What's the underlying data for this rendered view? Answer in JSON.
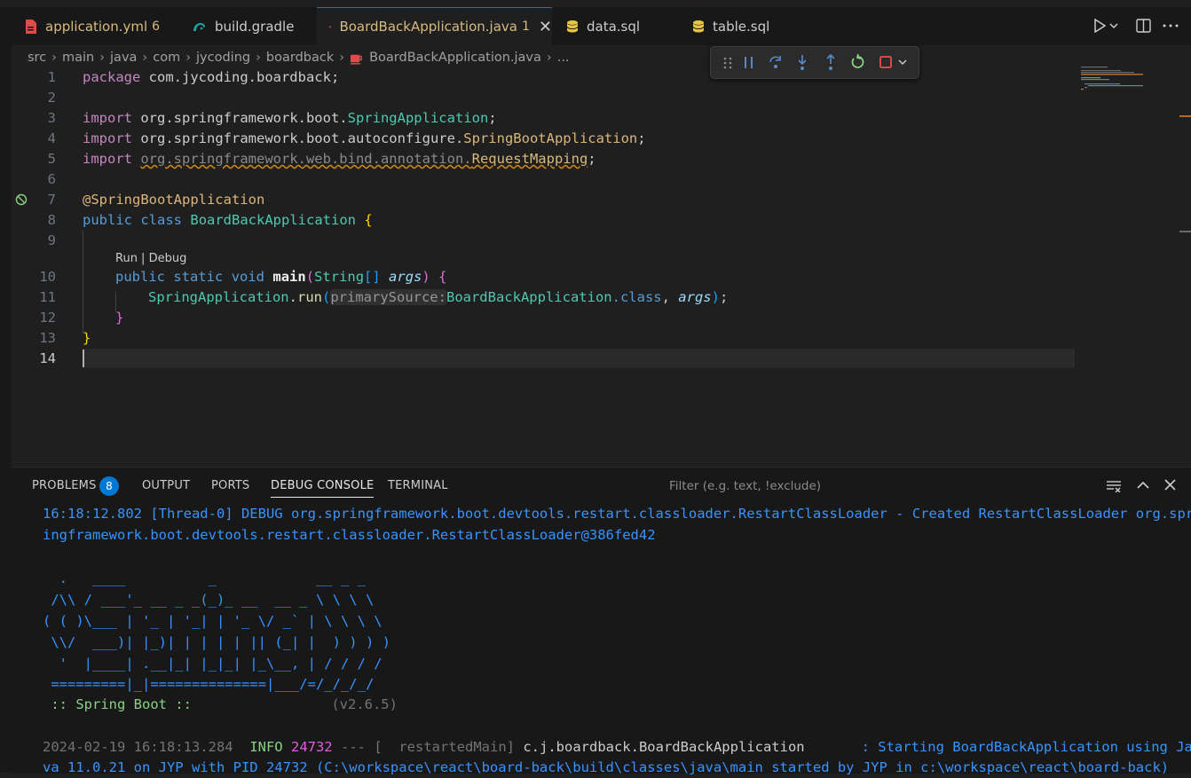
{
  "tabs": [
    {
      "label": "application.yml",
      "badge": "6",
      "color": "#d7ba7d",
      "icon": "yaml-icon"
    },
    {
      "label": "build.gradle",
      "color": "#cccccc",
      "icon": "gradle-icon"
    },
    {
      "label": "BoardBackApplication.java",
      "badge": "1",
      "color": "#d7ba7d",
      "icon": "java-icon",
      "active": true,
      "close": "✕"
    },
    {
      "label": "data.sql",
      "color": "#cccccc",
      "icon": "database-icon"
    },
    {
      "label": "table.sql",
      "color": "#cccccc",
      "icon": "database-icon"
    }
  ],
  "breadcrumb": [
    "src",
    "main",
    "java",
    "com",
    "jycoding",
    "boardback",
    "BoardBackApplication.java",
    "..."
  ],
  "editor": {
    "line_numbers": [
      "1",
      "2",
      "3",
      "4",
      "5",
      "6",
      "7",
      "8",
      "9",
      "10",
      "11",
      "12",
      "13",
      "14"
    ],
    "codelens": "Run | Debug",
    "pkg_kw": "package",
    "pkg_name": "com.jycoding.boardback;",
    "import_kw": "import",
    "imp1_pre": "org.springframework.boot.",
    "imp1_cls": "SpringApplication",
    "imp1_end": ";",
    "imp2_pre": "org.springframework.boot.autoconfigure.",
    "imp2_cls": "SpringBootApplication",
    "imp2_end": ";",
    "imp3_pre": "org.springframework.web.bind.annotation.",
    "imp3_cls": "RequestMapping",
    "imp3_end": ";",
    "annotation": "@SpringBootApplication",
    "cls_kw1": "public",
    "cls_kw2": "class",
    "cls_name": "BoardBackApplication",
    "brace_open": "{",
    "m_public": "public",
    "m_static": "static",
    "m_void": "void",
    "m_name": "main",
    "m_paren_open": "(",
    "m_type": "String",
    "m_arr": "[]",
    "m_arg": "args",
    "m_paren_close": ")",
    "m_brace": "{",
    "r_cls": "SpringApplication",
    "r_dot": ".",
    "r_fn": "run",
    "r_paren": "(",
    "r_hint": "primarySource:",
    "r_arg1": "BoardBackApplication",
    "r_dotclass": ".class",
    "r_comma": ", ",
    "r_arg2": "args",
    "r_close": ")",
    "r_semi": ";",
    "m_close": "}",
    "cls_close": "}"
  },
  "panel": {
    "tabs": [
      "PROBLEMS",
      "OUTPUT",
      "PORTS",
      "DEBUG CONSOLE",
      "TERMINAL"
    ],
    "problems_count": "8",
    "filter_placeholder": "Filter (e.g. text, !exclude)",
    "log1_line1": "16:18:12.802 [Thread-0] DEBUG org.springframework.boot.devtools.restart.classloader.RestartClassLoader - Created RestartClassLoader org.spr",
    "log1_line2": "ingframework.boot.devtools.restart.classloader.RestartClassLoader@386fed42",
    "banner": [
      "  .   ____          _            __ _ _",
      " /\\\\ / ___'_ __ _ _(_)_ __  __ _ \\ \\ \\ \\",
      "( ( )\\___ | '_ | '_| | '_ \\/ _` | \\ \\ \\ \\",
      " \\\\/  ___)| |_)| | | | | || (_| |  ) ) ) )",
      "  '  |____| .__|_| |_|_| |_\\__, | / / / /",
      " =========|_|==============|___/=/_/_/_/"
    ],
    "sb_label": " :: Spring Boot :: ",
    "sb_version": "(v2.6.5)",
    "log2_ts": "2024-02-19 16:18:13.284",
    "log2_level": "INFO",
    "log2_pid": "24732",
    "log2_sep": "--- [",
    "log2_thread": "  restartedMain]",
    "log2_logger": "c.j.boardback.BoardBackApplication",
    "log2_msg": ": Starting BoardBackApplication using Ja",
    "log2_line2": "va 11.0.21 on JYP with PID 24732 (C:\\workspace\\react\\board-back\\build\\classes\\java\\main started by JYP in c:\\workspace\\react\\board-back)"
  }
}
